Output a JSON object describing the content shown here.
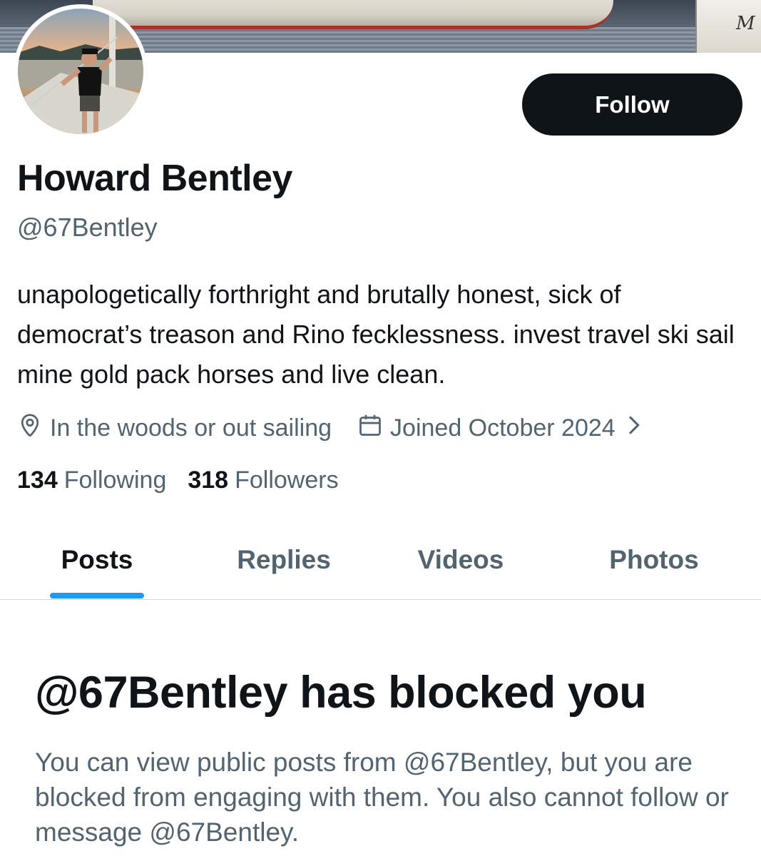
{
  "banner": {
    "boat_lettering": "M"
  },
  "profile": {
    "name": "Howard Bentley",
    "handle": "@67Bentley",
    "bio": "unapologetically forthright and brutally honest, sick of democrat’s treason and Rino fecklessness. invest travel ski sail mine gold pack horses and live clean.",
    "location": "In the woods or out sailing",
    "joined": "Joined October 2024",
    "following_count": "134",
    "following_label": "Following",
    "followers_count": "318",
    "followers_label": "Followers"
  },
  "actions": {
    "follow_label": "Follow"
  },
  "tabs": [
    {
      "label": "Posts",
      "active": true
    },
    {
      "label": "Replies",
      "active": false
    },
    {
      "label": "Videos",
      "active": false
    },
    {
      "label": "Photos",
      "active": false
    }
  ],
  "blocked": {
    "title": "@67Bentley has blocked you",
    "description": "You can view public posts from @67Bentley, but you are blocked from engaging with them. You also cannot follow or message @67Bentley."
  },
  "icons": {
    "location": "location-pin-icon",
    "joined": "calendar-icon",
    "chevron": "chevron-right-icon"
  },
  "colors": {
    "text_primary": "#0f1419",
    "text_secondary": "#536471",
    "accent": "#1d9bf0",
    "follow_button_bg": "#0f1419"
  }
}
